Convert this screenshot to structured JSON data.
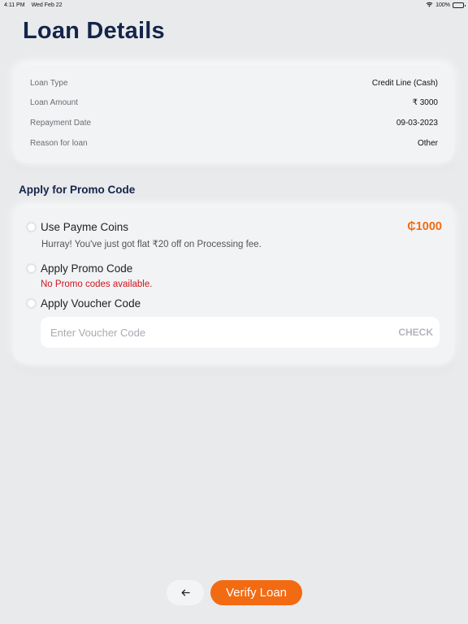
{
  "status_bar": {
    "time": "4:11 PM",
    "date": "Wed Feb 22",
    "battery": "100%",
    "icons": [
      "wifi-icon",
      "battery-icon"
    ]
  },
  "page": {
    "title": "Loan Details"
  },
  "details": {
    "rows": [
      {
        "label": "Loan Type",
        "value": "Credit Line (Cash)"
      },
      {
        "label": "Loan Amount",
        "value": "₹ 3000"
      },
      {
        "label": "Repayment Date",
        "value": "09-03-2023"
      },
      {
        "label": "Reason for loan",
        "value": "Other"
      }
    ]
  },
  "promo": {
    "section_title": "Apply for Promo Code",
    "payme_coins": {
      "label": "Use Payme Coins",
      "amount": "₵1000",
      "hint": "Hurray! You've just got flat ₹20 off on Processing fee."
    },
    "promo_code": {
      "label": "Apply Promo Code",
      "hint": "No Promo codes available."
    },
    "voucher": {
      "label": "Apply Voucher Code",
      "placeholder": "Enter Voucher Code",
      "value": "",
      "check_label": "CHECK"
    }
  },
  "footer": {
    "back_icon": "arrow-left-icon",
    "verify_label": "Verify Loan"
  },
  "colors": {
    "accent": "#f26b12",
    "title": "#14254a",
    "error": "#d0141c",
    "background": "#e9eaec"
  }
}
